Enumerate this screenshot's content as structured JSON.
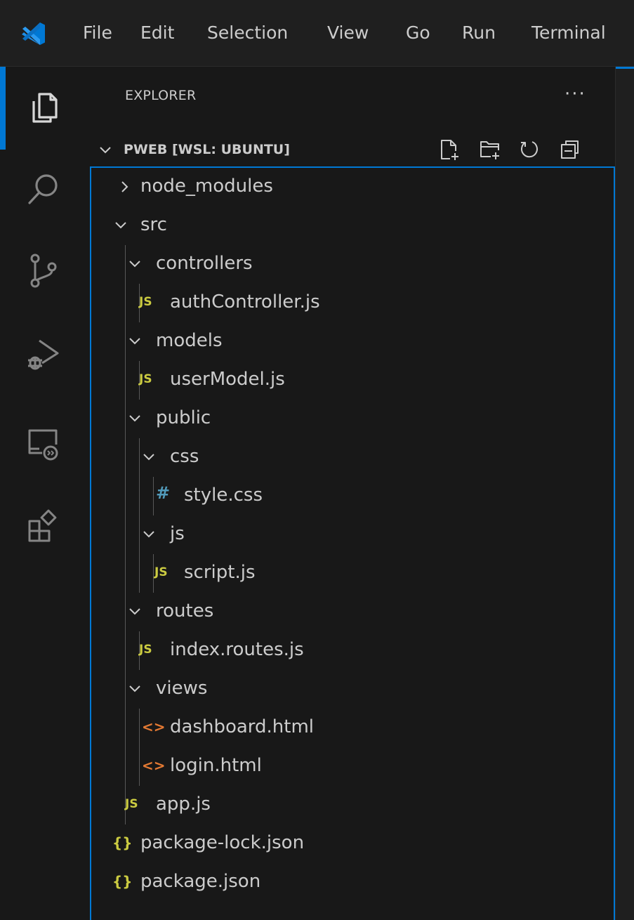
{
  "menu": [
    "File",
    "Edit",
    "Selection",
    "View",
    "Go",
    "Run",
    "Terminal"
  ],
  "activity_bar": [
    "explorer-icon",
    "search-icon",
    "source-control-icon",
    "run-debug-icon",
    "remote-explorer-icon",
    "extensions-icon"
  ],
  "explorer": {
    "title": "EXPLORER",
    "more": "···",
    "workspace": "PWEB [WSL: UBUNTU]",
    "header_actions": [
      "new-file-icon",
      "new-folder-icon",
      "refresh-icon",
      "collapse-all-icon"
    ]
  },
  "tree": [
    {
      "label": "node_modules",
      "type": "folder",
      "expanded": false
    },
    {
      "label": "src",
      "type": "folder",
      "expanded": true
    },
    {
      "label": "controllers",
      "type": "folder",
      "expanded": true
    },
    {
      "label": "authController.js",
      "type": "js",
      "icon": "JS"
    },
    {
      "label": "models",
      "type": "folder",
      "expanded": true
    },
    {
      "label": "userModel.js",
      "type": "js",
      "icon": "JS"
    },
    {
      "label": "public",
      "type": "folder",
      "expanded": true
    },
    {
      "label": "css",
      "type": "folder",
      "expanded": true
    },
    {
      "label": "style.css",
      "type": "css",
      "icon": "#"
    },
    {
      "label": "js",
      "type": "folder",
      "expanded": true
    },
    {
      "label": "script.js",
      "type": "js",
      "icon": "JS"
    },
    {
      "label": "routes",
      "type": "folder",
      "expanded": true
    },
    {
      "label": "index.routes.js",
      "type": "js",
      "icon": "JS"
    },
    {
      "label": "views",
      "type": "folder",
      "expanded": true
    },
    {
      "label": "dashboard.html",
      "type": "html",
      "icon": "<>"
    },
    {
      "label": "login.html",
      "type": "html",
      "icon": "<>"
    },
    {
      "label": "app.js",
      "type": "js",
      "icon": "JS"
    },
    {
      "label": "package-lock.json",
      "type": "json",
      "icon": "{}"
    },
    {
      "label": "package.json",
      "type": "json",
      "icon": "{}"
    }
  ],
  "colors": {
    "accent": "#0078d4",
    "js": "#cbcb41",
    "css": "#519aba",
    "html": "#e37933",
    "json": "#cbcb41"
  }
}
